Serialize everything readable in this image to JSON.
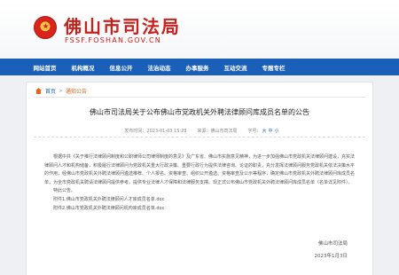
{
  "header": {
    "site_title": "佛山市司法局",
    "site_url": "FSSF.FOSHAN.GOV.CN"
  },
  "nav": {
    "items": [
      "网站首页",
      "机构概况",
      "信息公开",
      "法治动态",
      "办事服务",
      "互动交流",
      "专题专栏"
    ]
  },
  "breadcrumb": {
    "home": "首页",
    "separator": ">",
    "current": "通知公告"
  },
  "article": {
    "title": "佛山市司法局关于公布佛山市党政机关外聘法律顾问库成员名单的公告",
    "date": "发布时间：2023-01-03 15:28",
    "source": "来源：佛山市司法局",
    "font_size_label": "字号：",
    "font_sizes": [
      "大",
      "中",
      "小"
    ],
    "paragraphs": [
      "根据中共《关于推行法律顾问制度和公职律师公司律师制度的意见》及广东省、佛山市实施意见精神，为进一步加强佛山市党政机关法律顾问建设，充实法律顾问人才和机构储备，积极履行法律顾问为党政机关重大行政决策、重要行政行为提供法律咨询、论证的职责，充分发挥法律顾问服务党政机关依法决策水平的作用，经佛山市党政机关外聘法律顾问遴选推荐、个人报名、资格审查、组织公开遴选、资格审查及公示等程序，确定佛山市党政机关外聘法律顾问库成员名单，为全市党政机关聘请法律顾问提供参考。提供专业法律人才保障和法律服务支撑。现正式公布佛山市党政机关外聘法律顾问库成员名单（名单详见附件）。"
    ],
    "special_notice": "特此公告。",
    "attachments": [
      "附件1.佛山市党政机关外聘法律顾问人才库成员名单.doc",
      "附件2.佛山市党政机关外聘法律顾问机构库成员名单.doc"
    ],
    "signature_org": "佛山市司法局",
    "signature_date": "2023年1月3日"
  }
}
